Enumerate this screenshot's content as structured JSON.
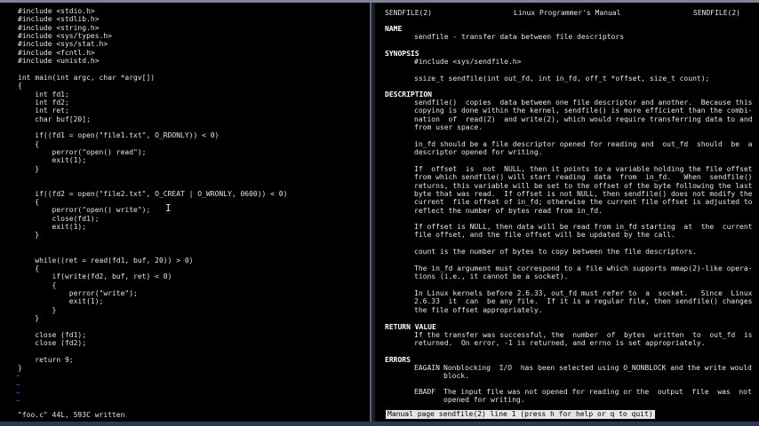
{
  "editor": {
    "lines": [
      "#include <stdio.h>",
      "#include <stdlib.h>",
      "#include <string.h>",
      "#include <sys/types.h>",
      "#include <sys/stat.h>",
      "#include <fcntl.h>",
      "#include <unistd.h>",
      "",
      "int main(int argc, char *argv[])",
      "{",
      "    int fd1;",
      "    int fd2;",
      "    int ret;",
      "    char buf[20];",
      "",
      "    if((fd1 = open(\"file1.txt\", O_RDONLY)) < 0)",
      "    {",
      "        perror(\"open() read\");",
      "        exit(1);",
      "    }",
      "",
      "",
      "    if((fd2 = open(\"file2.txt\", O_CREAT | O_WRONLY, 0600)) < 0)",
      "    {",
      "        perror(\"open() write\");",
      "        close(fd1);",
      "        exit(1);",
      "    }",
      "",
      "",
      "    while((ret = read(fd1, buf, 20)) > 0)",
      "    {",
      "        if(write(fd2, buf, ret) < 0)",
      "        {",
      "            perror(\"write\");",
      "            exit(1);",
      "        }",
      "    }",
      "",
      "    close (fd1);",
      "    close (fd2);",
      "",
      "    return 9;",
      "}"
    ],
    "tilde": "~",
    "status": "\"foo.c\" 44L, 593C written"
  },
  "manpage": {
    "header_left": "SENDFILE(2)",
    "header_center": "Linux Programmer's Manual",
    "header_right": "SENDFILE(2)",
    "name_heading": "NAME",
    "name_text": "sendfile - transfer data between file descriptors",
    "synopsis_heading": "SYNOPSIS",
    "synopsis_include": "#include <sys/sendfile.h>",
    "synopsis_proto": "ssize_t sendfile(int out_fd, int in_fd, off_t *offset, size_t count);",
    "description_heading": "DESCRIPTION",
    "desc_p1": [
      "sendfile()  copies  data between one file descriptor and another.  Because this",
      "copying is done within the kernel, sendfile() is more efficient than the combi-",
      "nation  of  read(2)  and write(2), which would require transferring data to and",
      "from user space."
    ],
    "desc_p2": [
      "in_fd should be a file descriptor opened for reading and  out_fd  should  be  a",
      "descriptor opened for writing."
    ],
    "desc_p3": [
      "If  offset  is  not  NULL, then it points to a variable holding the file offset",
      "from which sendfile() will start reading  data  from  in_fd.   When  sendfile()",
      "returns, this variable will be set to the offset of the byte following the last",
      "byte that was read.  If offset is not NULL, then sendfile() does not modify the",
      "current  file offset of in_fd; otherwise the current file offset is adjusted to",
      "reflect the number of bytes read from in_fd."
    ],
    "desc_p4": [
      "If offset is NULL, then data will be read from in_fd starting  at  the  current",
      "file offset, and the file offset will be updated by the call."
    ],
    "desc_p5": [
      "count is the number of bytes to copy between the file descriptors."
    ],
    "desc_p6": [
      "The in_fd argument must correspond to a file which supports mmap(2)-like opera-",
      "tions (i.e., it cannot be a socket)."
    ],
    "desc_p7": [
      "In Linux kernels before 2.6.33, out_fd must refer to  a  socket.   Since  Linux",
      "2.6.33  it  can  be any file.  If it is a regular file, then sendfile() changes",
      "the file offset appropriately."
    ],
    "return_heading": "RETURN VALUE",
    "return_text": [
      "If the transfer was successful, the  number  of  bytes  written  to  out_fd  is",
      "returned.  On error, -1 is returned, and errno is set appropriately."
    ],
    "errors_heading": "ERRORS",
    "eagain_name": "EAGAIN",
    "eagain_text": [
      "Nonblocking  I/O  has been selected using O_NONBLOCK and the write would",
      "block."
    ],
    "ebadf_name": "EBADF",
    "ebadf_text": [
      "The input file was not opened for reading or the  output  file  was  not",
      "opened for writing."
    ],
    "status": "Manual page sendfile(2) line 1 (press h for help or q to quit)"
  }
}
